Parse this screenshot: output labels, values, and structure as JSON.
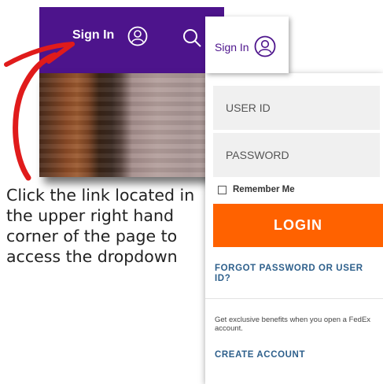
{
  "background_header": {
    "signin_label": "Sign In",
    "avatar_icon": "user-circle-icon",
    "search_icon": "search-icon",
    "color": "#4d148c"
  },
  "instruction": {
    "text": "Click the link located in the upper right hand corner of the page to access the dropdown"
  },
  "dropdown": {
    "signin_label": "Sign In",
    "avatar_icon": "user-circle-icon",
    "user_id_placeholder": "USER ID",
    "password_placeholder": "PASSWORD",
    "remember_me_label": "Remember Me",
    "login_label": "LOGIN",
    "forgot_label": "FORGOT PASSWORD OR USER ID?",
    "benefits_text": "Get exclusive benefits when you open a FedEx account.",
    "create_account_label": "CREATE ACCOUNT",
    "accent_color": "#ff6200",
    "link_color": "#2d5f8b"
  },
  "annotation": {
    "arrow_color": "#e01b1b"
  }
}
